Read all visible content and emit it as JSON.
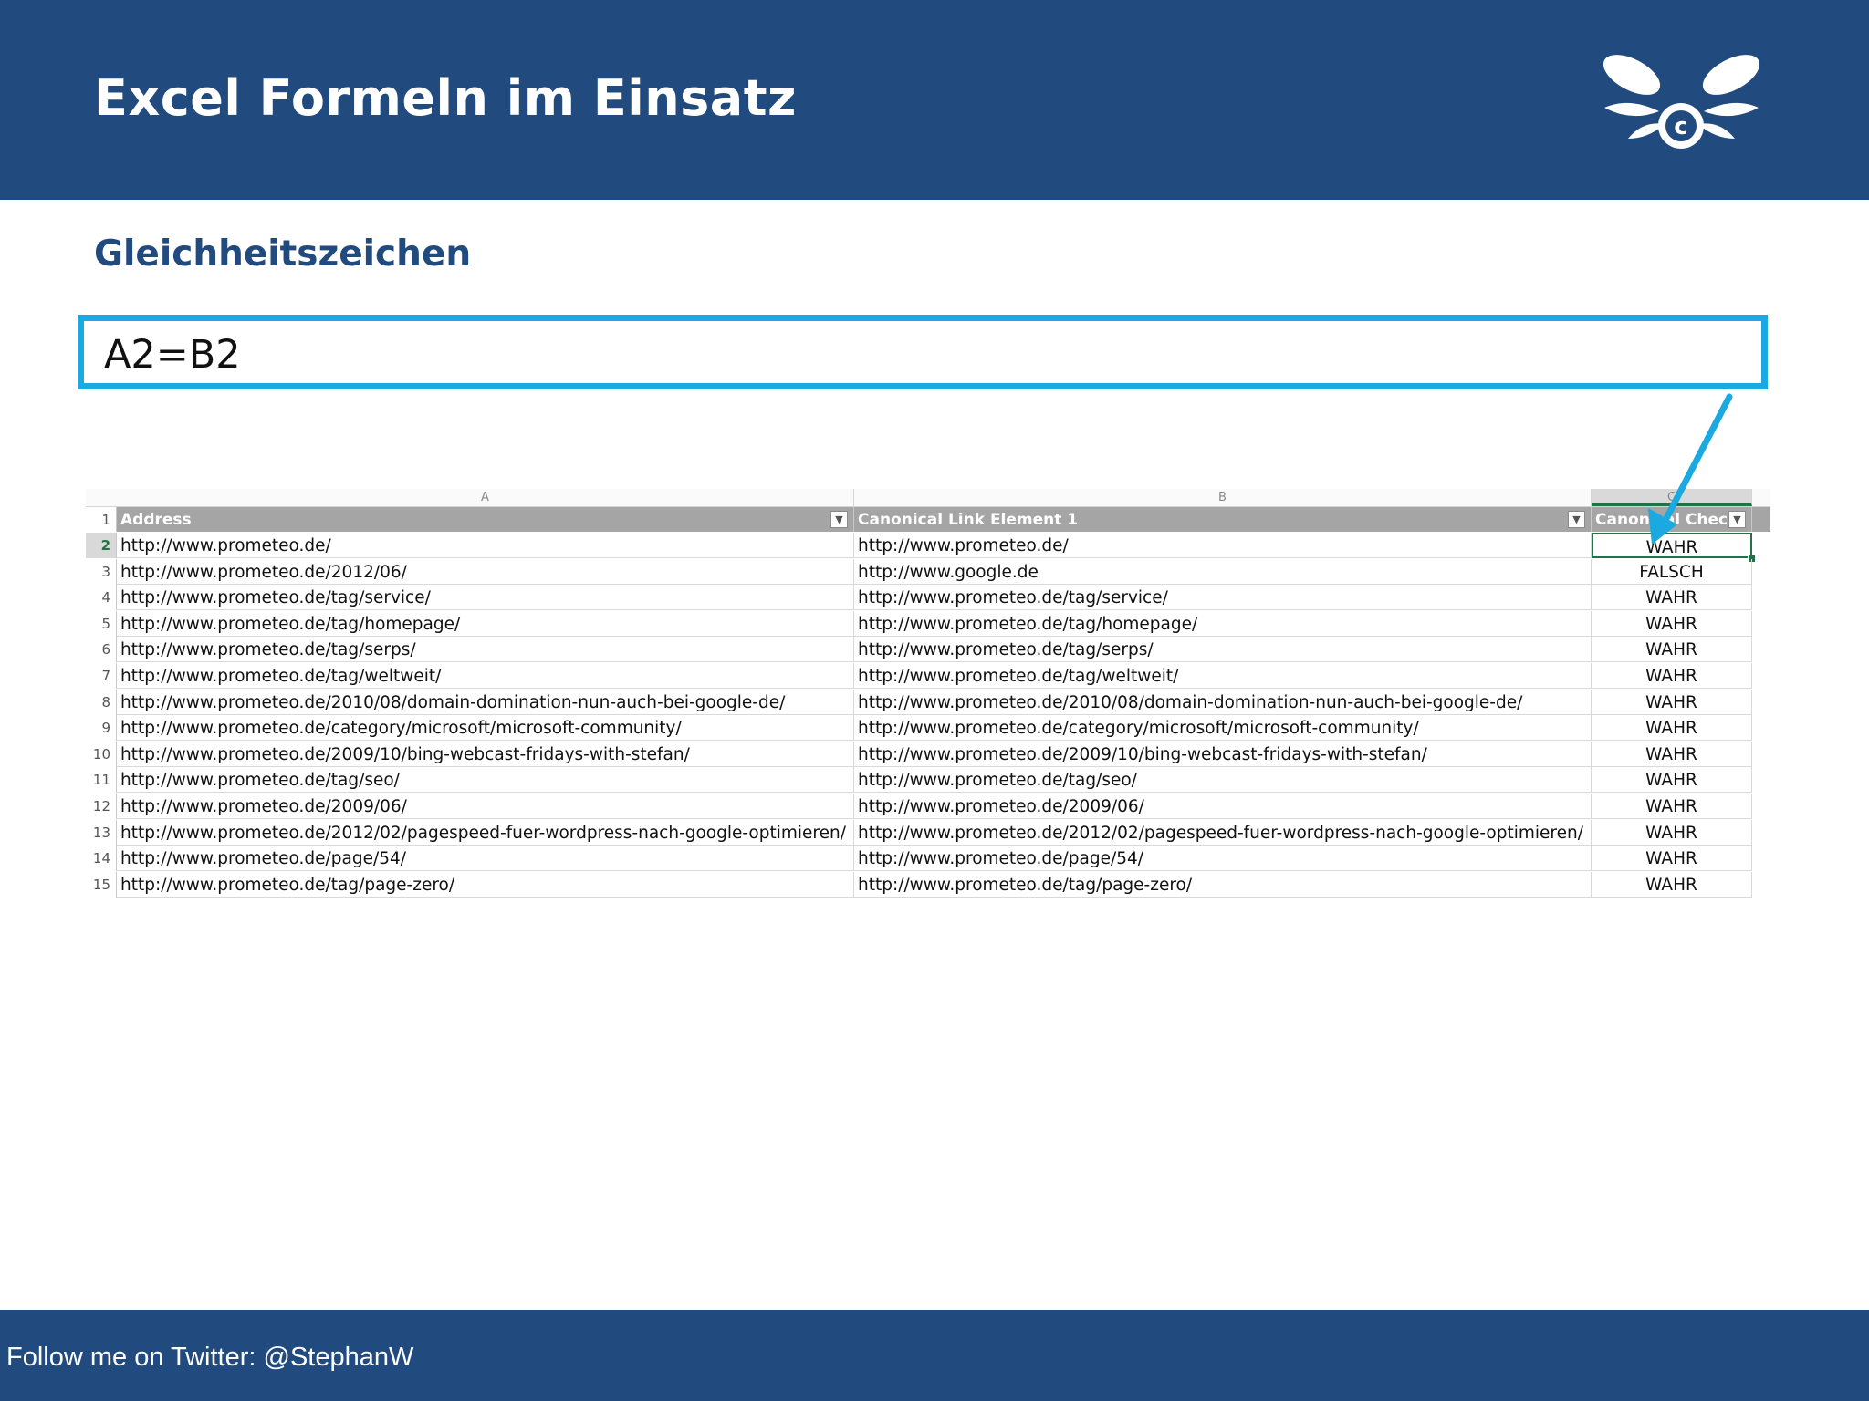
{
  "slide": {
    "title": "Excel Formeln im Einsatz",
    "subtitle": "Gleichheitszeichen",
    "formula": "A2=B2",
    "footer": "Follow me on Twitter: @StephanW",
    "logo_icon": "winged-c-logo-icon"
  },
  "colors": {
    "brand_blue": "#214a7e",
    "accent_cyan": "#1aa9e0",
    "excel_green": "#217346",
    "table_header_gray": "#a5a5a5"
  },
  "sheet": {
    "column_letters": [
      "A",
      "B",
      "C"
    ],
    "headers": [
      "Address",
      "Canonical Link Element 1",
      "Canonical Check"
    ],
    "active_row": 2,
    "rows": [
      {
        "num": "1"
      },
      {
        "num": "2",
        "a": "http://www.prometeo.de/",
        "b": "http://www.prometeo.de/",
        "c": "WAHR"
      },
      {
        "num": "3",
        "a": "http://www.prometeo.de/2012/06/",
        "b": "http://www.google.de",
        "c": "FALSCH"
      },
      {
        "num": "4",
        "a": "http://www.prometeo.de/tag/service/",
        "b": "http://www.prometeo.de/tag/service/",
        "c": "WAHR"
      },
      {
        "num": "5",
        "a": "http://www.prometeo.de/tag/homepage/",
        "b": "http://www.prometeo.de/tag/homepage/",
        "c": "WAHR"
      },
      {
        "num": "6",
        "a": "http://www.prometeo.de/tag/serps/",
        "b": "http://www.prometeo.de/tag/serps/",
        "c": "WAHR"
      },
      {
        "num": "7",
        "a": "http://www.prometeo.de/tag/weltweit/",
        "b": "http://www.prometeo.de/tag/weltweit/",
        "c": "WAHR"
      },
      {
        "num": "8",
        "a": "http://www.prometeo.de/2010/08/domain-domination-nun-auch-bei-google-de/",
        "b": "http://www.prometeo.de/2010/08/domain-domination-nun-auch-bei-google-de/",
        "c": "WAHR"
      },
      {
        "num": "9",
        "a": "http://www.prometeo.de/category/microsoft/microsoft-community/",
        "b": "http://www.prometeo.de/category/microsoft/microsoft-community/",
        "c": "WAHR"
      },
      {
        "num": "10",
        "a": "http://www.prometeo.de/2009/10/bing-webcast-fridays-with-stefan/",
        "b": "http://www.prometeo.de/2009/10/bing-webcast-fridays-with-stefan/",
        "c": "WAHR"
      },
      {
        "num": "11",
        "a": "http://www.prometeo.de/tag/seo/",
        "b": "http://www.prometeo.de/tag/seo/",
        "c": "WAHR"
      },
      {
        "num": "12",
        "a": "http://www.prometeo.de/2009/06/",
        "b": "http://www.prometeo.de/2009/06/",
        "c": "WAHR"
      },
      {
        "num": "13",
        "a": "http://www.prometeo.de/2012/02/pagespeed-fuer-wordpress-nach-google-optimieren/",
        "b": "http://www.prometeo.de/2012/02/pagespeed-fuer-wordpress-nach-google-optimieren/",
        "c": "WAHR"
      },
      {
        "num": "14",
        "a": "http://www.prometeo.de/page/54/",
        "b": "http://www.prometeo.de/page/54/",
        "c": "WAHR"
      },
      {
        "num": "15",
        "a": "http://www.prometeo.de/tag/page-zero/",
        "b": "http://www.prometeo.de/tag/page-zero/",
        "c": "WAHR"
      }
    ]
  }
}
